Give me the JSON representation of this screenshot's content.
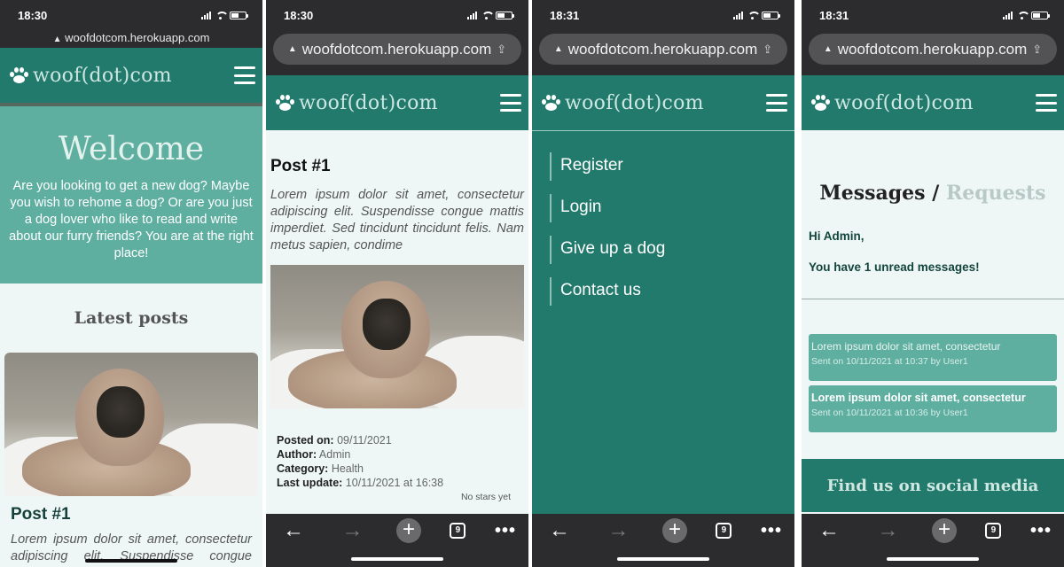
{
  "phones": [
    {
      "time": "18:30",
      "url": "woofdotcom.herokuapp.com"
    },
    {
      "time": "18:30",
      "url": "woofdotcom.herokuapp.com"
    },
    {
      "time": "18:31",
      "url": "woofdotcom.herokuapp.com"
    },
    {
      "time": "18:31",
      "url": "woofdotcom.herokuapp.com"
    }
  ],
  "site": {
    "logo_text": "woof(dot)com"
  },
  "home": {
    "welcome": "Welcome",
    "intro": "Are you looking to get a new dog? Maybe you wish to rehome a dog? Or are you just a dog lover who like to read and write about our furry friends? You are at the right place!",
    "latest_posts": "Latest posts",
    "post_title": "Post #1",
    "post_excerpt": "Lorem ipsum dolor sit amet, consectetur adipiscing elit. Suspendisse congue mattis"
  },
  "post": {
    "title": "Post #1",
    "excerpt": "Lorem ipsum dolor sit amet, consectetur adipiscing elit. Suspendisse congue mattis imperdiet. Sed tincidunt tincidunt felis. Nam metus sapien, condime",
    "meta": {
      "posted_on_label": "Posted on:",
      "posted_on": "09/11/2021",
      "author_label": "Author:",
      "author": "Admin",
      "category_label": "Category:",
      "category": "Health",
      "last_update_label": "Last update:",
      "last_update": "10/11/2021 at 16:38"
    },
    "stars": "No stars yet"
  },
  "menu": {
    "items": [
      "Register",
      "Login",
      "Give up a dog",
      "Contact us"
    ]
  },
  "messages": {
    "title_messages": "Messages",
    "title_sep": "/",
    "title_requests": "Requests",
    "greeting": "Hi Admin,",
    "unread": "You have 1 unread messages!",
    "items": [
      {
        "title": "Lorem ipsum dolor sit amet, consectetur",
        "sent": "Sent on 10/11/2021 at 10:37 by User1",
        "unread": false
      },
      {
        "title": "Lorem ipsum dolor sit amet, consectetur",
        "sent": "Sent on 10/11/2021 at 10:36 by User1",
        "unread": true
      }
    ],
    "footer": "Find us on social media"
  },
  "toolbar": {
    "back": "←",
    "forward": "→",
    "new_tab": "+",
    "tab_count": "9",
    "more": "•••"
  },
  "colors": {
    "primary": "#227a6c",
    "hero": "#5fafa1",
    "page_bg": "#eef7f6",
    "chrome": "#2c2c2e"
  }
}
